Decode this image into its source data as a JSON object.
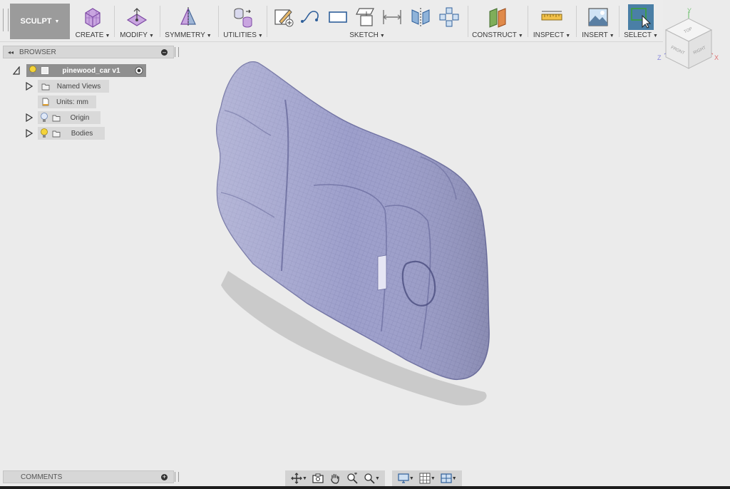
{
  "toolbar": {
    "workspace": "SCULPT",
    "groups": [
      {
        "label": "CREATE",
        "icon": "create-box-icon"
      },
      {
        "label": "MODIFY",
        "icon": "modify-icon"
      },
      {
        "label": "SYMMETRY",
        "icon": "symmetry-icon"
      },
      {
        "label": "UTILITIES",
        "icon": "utilities-icon"
      },
      {
        "label": "SKETCH",
        "icon": "sketch-icon"
      },
      {
        "label": "CONSTRUCT",
        "icon": "construct-plane-icon"
      },
      {
        "label": "INSPECT",
        "icon": "measure-ruler-icon"
      },
      {
        "label": "INSERT",
        "icon": "insert-image-icon"
      },
      {
        "label": "SELECT",
        "icon": "select-cursor-icon"
      }
    ]
  },
  "viewcube": {
    "top": "TOP",
    "front": "FRONT",
    "right": "RIGHT",
    "axis_x": "X",
    "axis_y": "Y",
    "axis_z": "Z"
  },
  "browser": {
    "title": "BROWSER",
    "root": "pinewood_car v1",
    "nodes": [
      {
        "label": "Named Views"
      },
      {
        "label": "Units: mm"
      },
      {
        "label": "Origin"
      },
      {
        "label": "Bodies"
      }
    ]
  },
  "comments": {
    "title": "COMMENTS"
  },
  "colors": {
    "model_fill": "#9a9cc9",
    "toolbar_bg": "#ececec",
    "workspace_btn": "#9b9b9b",
    "select_btn": "#4a7fa6"
  }
}
